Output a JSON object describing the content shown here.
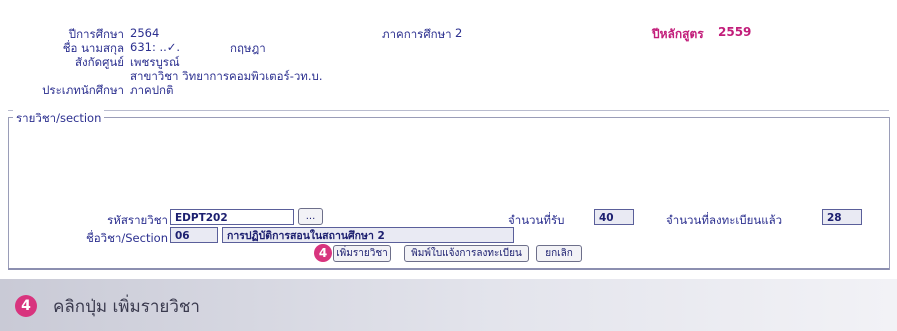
{
  "student": {
    "year_label": "ปีการศึกษา",
    "year_value": "2564",
    "name_label": "ชื่อ นามสกุล",
    "name_id": "631: ..✓.",
    "name_value": "กฤษฎา",
    "affiliation_label": "สังกัดศูนย์",
    "affiliation_value": "เพชรบูรณ์",
    "major_value": "สาขาวิชา วิทยาการคอมพิวเตอร์-วท.บ.",
    "type_label": "ประเภทนักศึกษา",
    "type_value": "ภาคปกติ",
    "semester_label": "ภาคการศึกษา",
    "semester_value": "2",
    "curriculum_label": "ปีหลักสูตร",
    "curriculum_value": "2559"
  },
  "section": {
    "legend": "รายวิชา/section",
    "course_code_label": "รหัสรายวิชา",
    "course_code_value": "EDPT202",
    "browse_label": "...",
    "course_name_label": "ชื่อวิชา/Section",
    "section_value": "06",
    "course_name_value": "การปฏิบัติการสอนในสถานศึกษา 2",
    "capacity_label": "จำนวนที่รับ",
    "capacity_value": "40",
    "enrolled_label": "จำนวนที่ลงทะเบียนแล้ว",
    "enrolled_value": "28"
  },
  "buttons": {
    "add_course": "เพิ่มรายวิชา",
    "print_slip": "พิมพ์ใบแจ้งการลงทะเบียน",
    "cancel": "ยกเลิก"
  },
  "step": {
    "number": "4",
    "caption": "คลิกปุ่ม เพิ่มรายวิชา"
  },
  "colors": {
    "accent": "#d8347e",
    "text": "#2b2f8f",
    "curriculum": "#c21d7a"
  }
}
